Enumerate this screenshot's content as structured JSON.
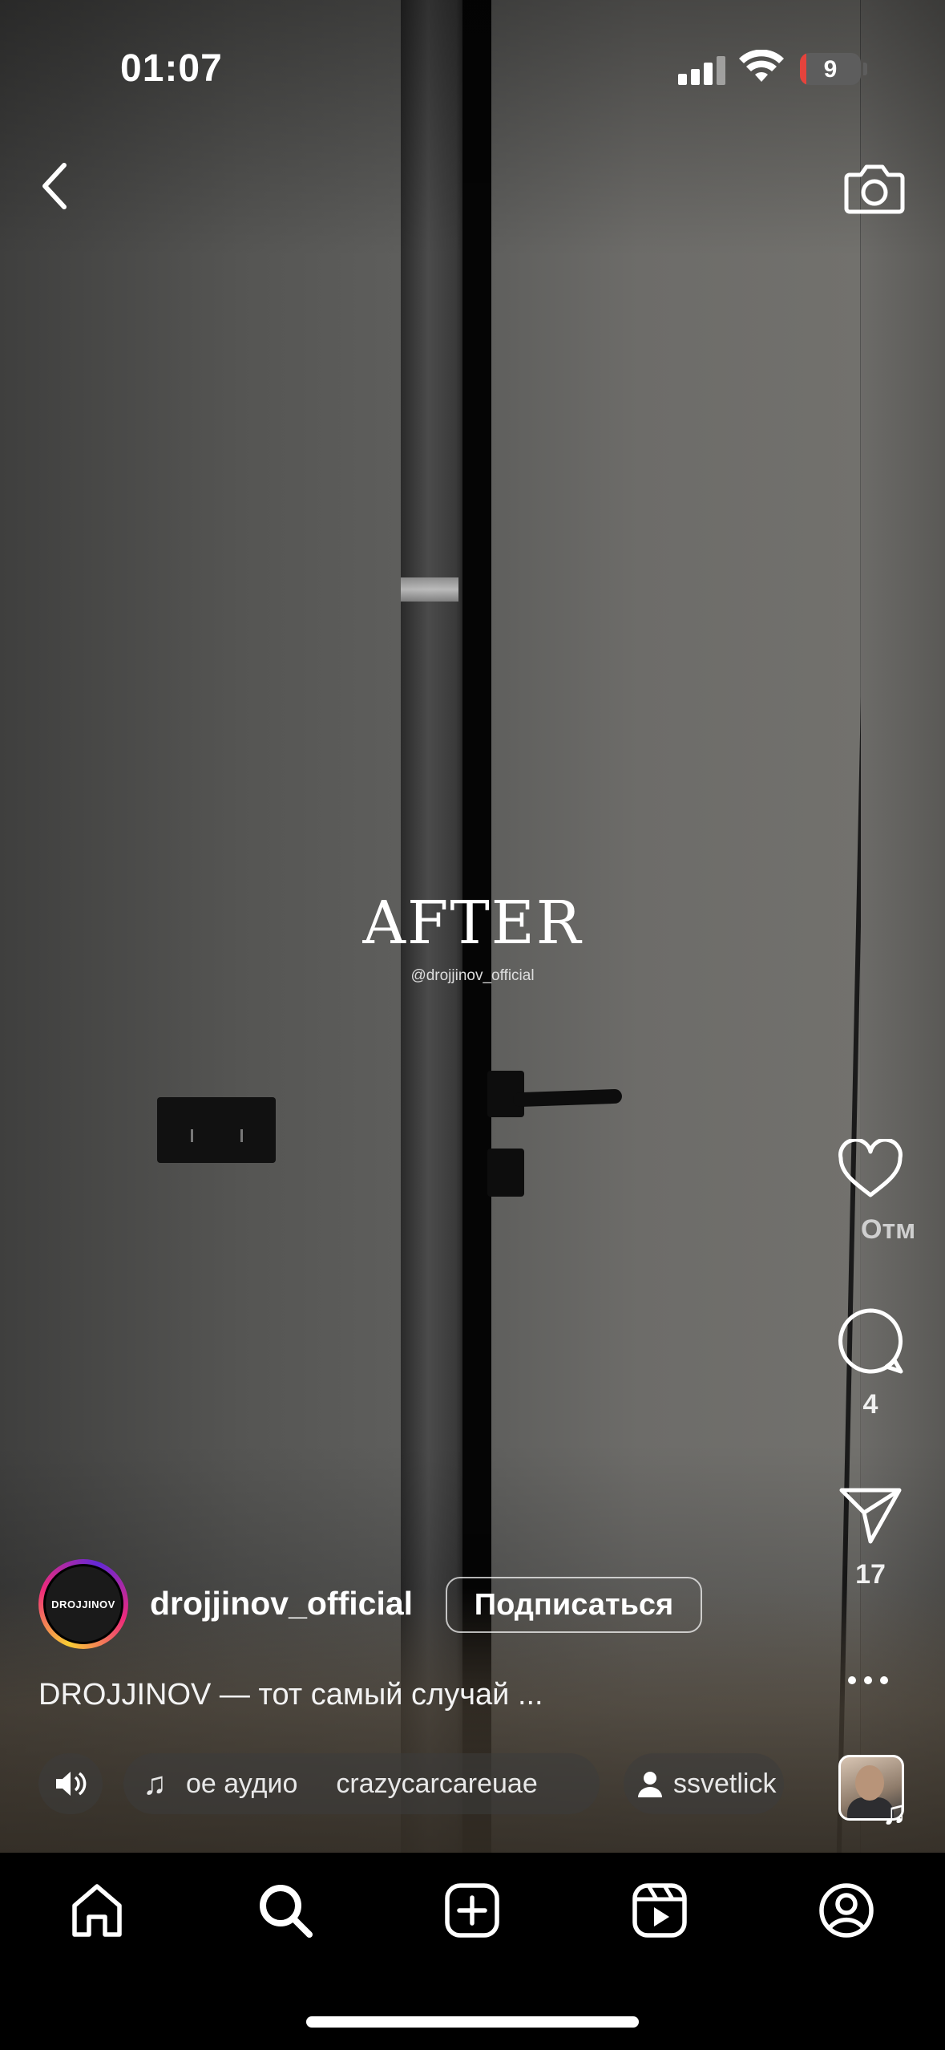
{
  "status_bar": {
    "time": "01:07",
    "battery_level": "9"
  },
  "overlay": {
    "title": "AFTER",
    "watermark": "@drojjinov_official"
  },
  "actions": {
    "like_label": "Отм",
    "comments_count": "4",
    "shares_count": "17"
  },
  "author": {
    "avatar_text": "DROJJINOV",
    "username": "drojjinov_official",
    "follow_label": "Подписаться"
  },
  "caption": "DROJJINOV — тот самый случай ...",
  "chips": {
    "audio_text": "ое аудио",
    "audio_author": "crazycarcareuae",
    "tagged_user": "ssvetlick"
  },
  "icons": {
    "back": "chevron-left-icon",
    "camera": "camera-icon",
    "like": "heart-icon",
    "comment": "comment-icon",
    "share": "send-icon",
    "more": "more-icon",
    "sound": "speaker-icon",
    "music": "music-note-icon",
    "person": "person-icon",
    "home": "home-icon",
    "search": "search-icon",
    "create": "plus-square-icon",
    "reels": "reels-icon",
    "profile": "profile-icon"
  },
  "colors": {
    "accent_battery_low": "#e5433c",
    "background": "#000000",
    "text": "#ffffff"
  }
}
